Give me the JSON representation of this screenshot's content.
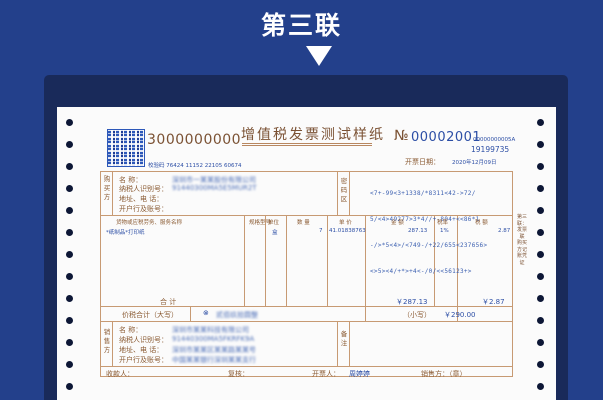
{
  "banner": {
    "title": "第三联"
  },
  "invoice": {
    "serial": "3000000000",
    "title": "增值税发票测试样纸",
    "no_symbol": "№",
    "no_value": "00002001",
    "no_small": "00000000005A",
    "no_second": "19199735",
    "date_label": "开票日期：",
    "date_value": "2020年12月09日",
    "check_code": "校验码 76424 11152 22105 60674",
    "buyer": {
      "side_label": "购买方",
      "name_label": "名 称：",
      "tax_label": "纳税人识别号：",
      "addr_label": "地址、电 话：",
      "bank_label": "开户行及账号：",
      "name_value": "深圳市一某某股份有限公司",
      "tax_value": "91440300MA5E5MUR2T"
    },
    "cipher_label": "密码区",
    "cipher_lines": [
      "<7+-99<3+1338/*8311<42->72/",
      "5/<4>49277>3*4//+-804+<<86*1",
      "-/>*5<4>/<749-/+22/655<237656>",
      "<>5><4/+*>+4<-/0/<<56123+>"
    ],
    "items": {
      "headers": {
        "name": "货物或应税劳务、服务名称",
        "spec": "规格型号",
        "unit": "单位",
        "qty": "数 量",
        "price": "单 价",
        "amount": "金 额",
        "rate": "税率",
        "tax": "税 额"
      },
      "rows": [
        {
          "name": "*纸制品*打印纸",
          "unit": "盒",
          "qty": "7",
          "price": "41.01838763",
          "amount": "287.13",
          "rate": "1%",
          "tax": "2.87"
        }
      ]
    },
    "subtotal_label": "合 计",
    "subtotal_amount": "￥287.13",
    "subtotal_tax": "￥2.87",
    "total_label": "价税合计（大写）",
    "total_chinese": "贰佰玖拾圆整",
    "total_small_label": "（小写）",
    "total_small_value": "￥290.00",
    "seller": {
      "side_label": "销售方",
      "name_label": "名 称：",
      "tax_label": "纳税人识别号：",
      "addr_label": "地址、电 话：",
      "bank_label": "开户行及账号：",
      "name_value": "深圳市某某科技有限公司",
      "tax_value": "91440300MA5FKRFK9A",
      "addr_value": "深圳市某某区某某路某某号",
      "bank_value": "中国某某银行深圳某某支行"
    },
    "remarks_label": "备注",
    "footer": {
      "payee_label": "收款人：",
      "reviewer_label": "复核：",
      "issuer_label": "开票人：",
      "issuer_value": "周婷婷",
      "seller_label": "销售方：（章）"
    },
    "side_note": "第三联：发票联 购买方记账凭证"
  }
}
